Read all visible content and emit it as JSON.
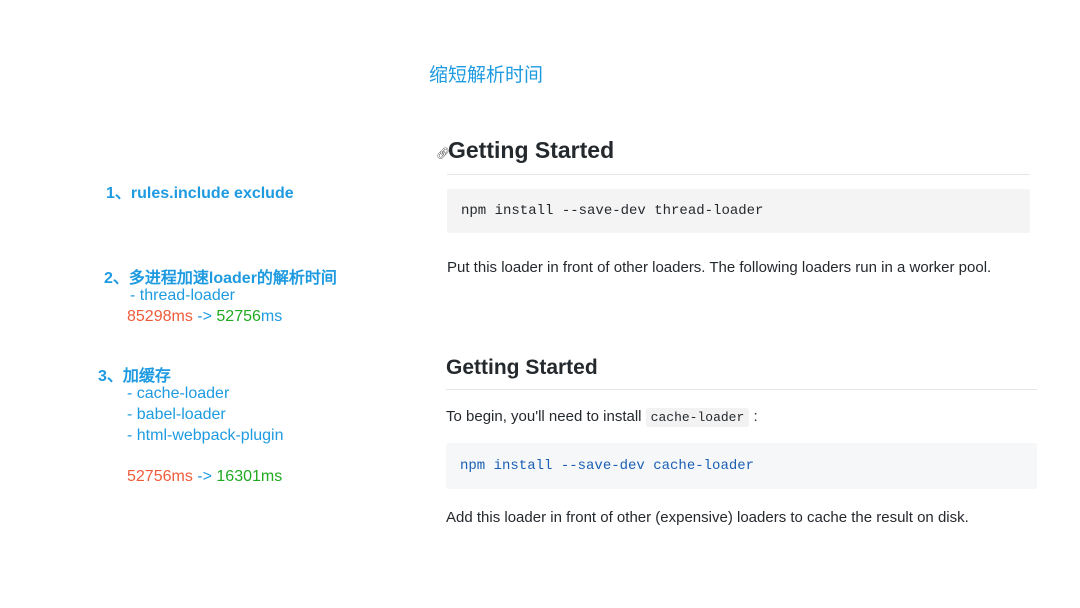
{
  "slide": {
    "title": "缩短解析时间"
  },
  "left": {
    "item1": {
      "heading": "1、rules.include exclude"
    },
    "item2": {
      "heading": "2、多进程加速loader的解析时间",
      "sub": "- thread-loader",
      "before": "85298ms",
      "arrow": " -> ",
      "after_value": "52756",
      "after_unit": "ms"
    },
    "item3": {
      "heading": "3、加缓存",
      "subs": [
        "- cache-loader",
        "- babel-loader",
        "- html-webpack-plugin"
      ],
      "before": "52756ms",
      "arrow": " -> ",
      "after": "16301ms"
    }
  },
  "doc1": {
    "anchor_icon": "link-icon",
    "heading": "Getting Started",
    "code": "npm install --save-dev thread-loader",
    "paragraph": "Put this loader in front of other loaders. The following loaders run in a worker pool."
  },
  "doc2": {
    "heading": "Getting Started",
    "intro": "To begin, you'll need to install",
    "intro_code": "cache-loader",
    "intro_suffix": ":",
    "code": "npm install --save-dev cache-loader",
    "paragraph": "Add this loader in front of other (expensive) loaders to cache the result on disk."
  },
  "colors": {
    "accent_blue": "#1e9be0",
    "time_before": "#ef5b3a",
    "time_after": "#1faa1f"
  }
}
